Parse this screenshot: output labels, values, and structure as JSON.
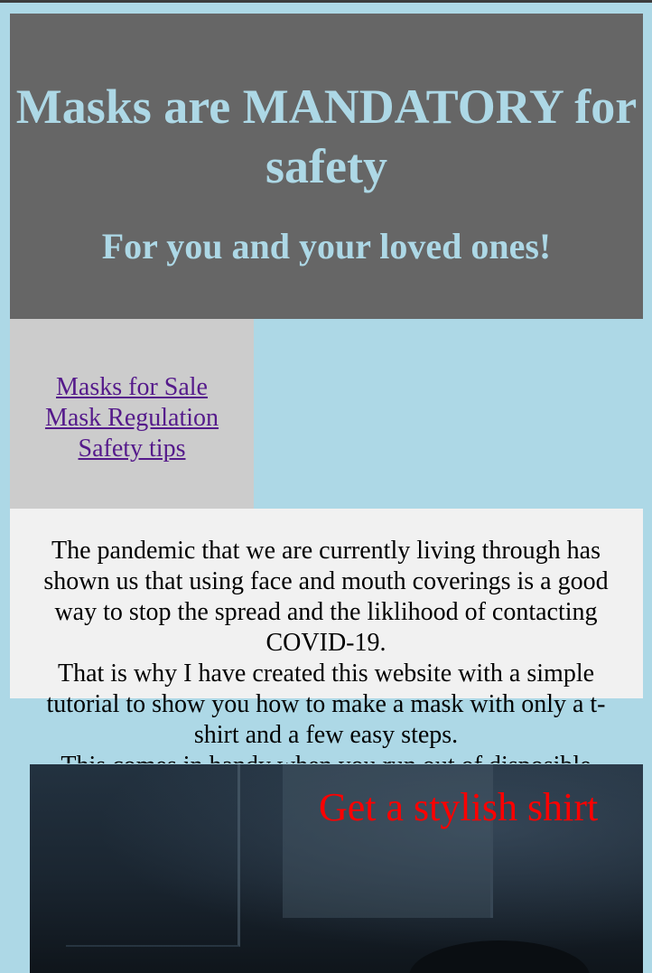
{
  "header": {
    "title": "Masks are MANDATORY for safety",
    "subtitle": "For you and your loved ones!"
  },
  "nav": {
    "items": [
      {
        "label": "Masks for Sale"
      },
      {
        "label": "Mask Regulation"
      },
      {
        "label": "Safety tips"
      }
    ]
  },
  "intro": {
    "paragraph_1": "The pandemic that we are currently living through has shown us that using face and mouth coverings is a good way to stop the spread and the liklihood of contacting COVID-19.",
    "paragraph_2": "That is why I have created this website with a simple tutorial to show you how to make a mask with only a t-shirt and a few easy steps.",
    "paragraph_3": "This comes in handy when you run out of disposible"
  },
  "video": {
    "caption": "Get a stylish shirt"
  },
  "colors": {
    "page_background": "#add8e6",
    "header_background": "#666666",
    "header_text": "#add8e6",
    "nav_background": "#cccccc",
    "link": "#551a8b",
    "panel_background": "#f1f1f1",
    "caption": "#ff0000"
  }
}
